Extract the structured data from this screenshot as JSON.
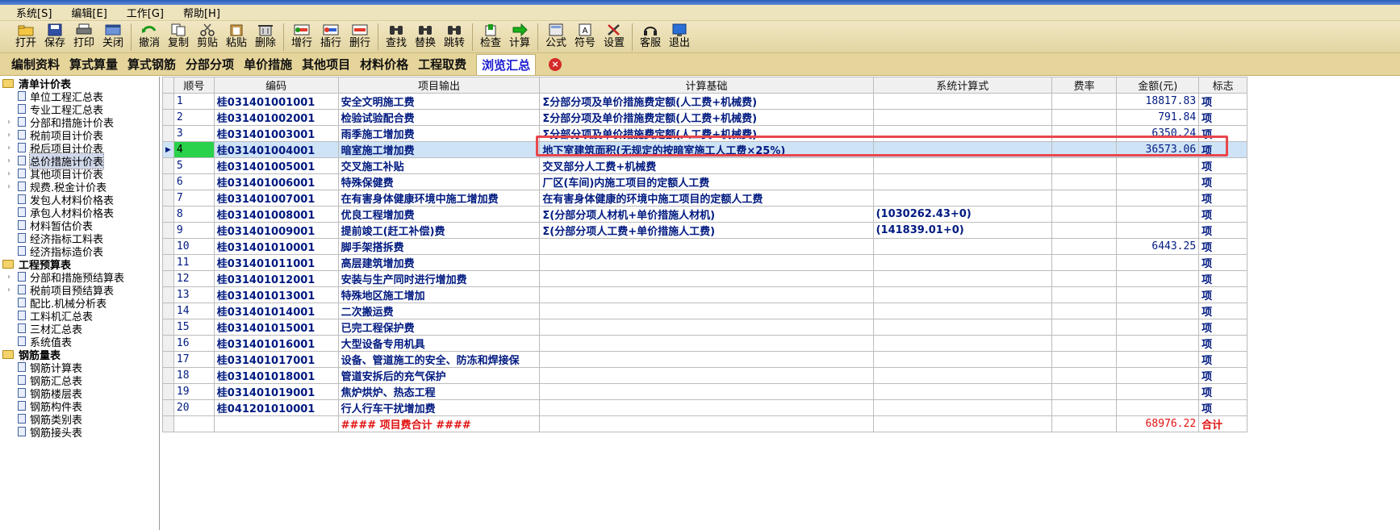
{
  "menu": [
    "系统[S]",
    "编辑[E]",
    "工作[G]",
    "帮助[H]"
  ],
  "toolbar": [
    {
      "label": "打开",
      "icon": "open-folder-icon"
    },
    {
      "label": "保存",
      "icon": "save-icon"
    },
    {
      "label": "打印",
      "icon": "print-icon"
    },
    {
      "label": "关闭",
      "icon": "close-window-icon"
    },
    {
      "sep": true
    },
    {
      "label": "撤消",
      "icon": "undo-icon"
    },
    {
      "label": "复制",
      "icon": "copy-icon"
    },
    {
      "label": "剪贴",
      "icon": "cut-icon"
    },
    {
      "label": "粘贴",
      "icon": "paste-icon"
    },
    {
      "label": "删除",
      "icon": "delete-icon"
    },
    {
      "sep": true
    },
    {
      "label": "增行",
      "icon": "add-row-icon"
    },
    {
      "label": "插行",
      "icon": "insert-row-icon"
    },
    {
      "label": "删行",
      "icon": "delete-row-icon"
    },
    {
      "sep": true
    },
    {
      "label": "查找",
      "icon": "find-icon"
    },
    {
      "label": "替换",
      "icon": "replace-icon"
    },
    {
      "label": "跳转",
      "icon": "jump-icon"
    },
    {
      "sep": true
    },
    {
      "label": "检查",
      "icon": "check-icon"
    },
    {
      "label": "计算",
      "icon": "calculate-icon"
    },
    {
      "sep": true
    },
    {
      "label": "公式",
      "icon": "formula-icon"
    },
    {
      "label": "符号",
      "icon": "symbol-icon"
    },
    {
      "label": "设置",
      "icon": "settings-icon"
    },
    {
      "sep": true
    },
    {
      "label": "客服",
      "icon": "headset-icon"
    },
    {
      "label": "退出",
      "icon": "exit-icon"
    }
  ],
  "tabs": [
    {
      "label": "编制资料",
      "active": false
    },
    {
      "label": "算式算量",
      "active": false
    },
    {
      "label": "算式钢筋",
      "active": false
    },
    {
      "label": "分部分项",
      "active": false
    },
    {
      "label": "单价措施",
      "active": false
    },
    {
      "label": "其他项目",
      "active": false
    },
    {
      "label": "材料价格",
      "active": false
    },
    {
      "label": "工程取费",
      "active": false
    },
    {
      "label": "浏览汇总",
      "active": true
    }
  ],
  "tree": [
    {
      "group": "清单计价表",
      "items": [
        {
          "label": "单位工程汇总表",
          "exp": false
        },
        {
          "label": "专业工程汇总表",
          "exp": false
        },
        {
          "label": "分部和措施计价表",
          "exp": true
        },
        {
          "label": "税前项目计价表",
          "exp": true
        },
        {
          "label": "税后项目计价表",
          "exp": true
        },
        {
          "label": "总价措施计价表",
          "exp": true,
          "selected": true
        },
        {
          "label": "其他项目计价表",
          "exp": true
        },
        {
          "label": "规费.税金计价表",
          "exp": true
        },
        {
          "label": "发包人材料价格表",
          "exp": false
        },
        {
          "label": "承包人材料价格表",
          "exp": false
        },
        {
          "label": "材料暂估价表",
          "exp": false
        },
        {
          "label": "经济指标工料表",
          "exp": false
        },
        {
          "label": "经济指标造价表",
          "exp": false
        }
      ]
    },
    {
      "group": "工程预算表",
      "items": [
        {
          "label": "分部和措施预结算表",
          "exp": true
        },
        {
          "label": "税前项目预结算表",
          "exp": true
        },
        {
          "label": "配比.机械分析表",
          "exp": false
        },
        {
          "label": "工料机汇总表",
          "exp": false
        },
        {
          "label": "三材汇总表",
          "exp": false
        },
        {
          "label": "系统值表",
          "exp": false
        }
      ]
    },
    {
      "group": "钢筋量表",
      "items": [
        {
          "label": "钢筋计算表",
          "exp": false
        },
        {
          "label": "钢筋汇总表",
          "exp": false
        },
        {
          "label": "钢筋楼层表",
          "exp": false
        },
        {
          "label": "钢筋构件表",
          "exp": false
        },
        {
          "label": "钢筋类别表",
          "exp": false
        },
        {
          "label": "钢筋接头表",
          "exp": false
        }
      ]
    }
  ],
  "grid": {
    "columns": [
      "顺号",
      "编码",
      "项目输出",
      "计算基础",
      "系统计算式",
      "费率",
      "金额(元)",
      "标志"
    ],
    "rows": [
      {
        "seq": "1",
        "code": "桂031401001001",
        "item": "安全文明施工费",
        "basis": "Σ分部分项及单价措施费定额(人工费+机械费)",
        "formula": "",
        "rate": "",
        "amount": "18817.83",
        "flag": "项"
      },
      {
        "seq": "2",
        "code": "桂031401002001",
        "item": "检验试验配合费",
        "basis": "Σ分部分项及单价措施费定额(人工费+机械费)",
        "formula": "",
        "rate": "",
        "amount": "791.84",
        "flag": "项"
      },
      {
        "seq": "3",
        "code": "桂031401003001",
        "item": "雨季施工增加费",
        "basis": "Σ分部分项及单价措施费定额(人工费+机械费)",
        "formula": "",
        "rate": "",
        "amount": "6350.24",
        "flag": "项"
      },
      {
        "seq": "4",
        "code": "桂031401004001",
        "item": "暗室施工增加费",
        "basis": "地下室建筑面积(无规定的按暗室施工人工费×25%)",
        "formula": "",
        "rate": "",
        "amount": "36573.06",
        "flag": "项",
        "selected": true
      },
      {
        "seq": "5",
        "code": "桂031401005001",
        "item": "交叉施工补贴",
        "basis": "交叉部分人工费+机械费",
        "formula": "",
        "rate": "",
        "amount": "",
        "flag": "项"
      },
      {
        "seq": "6",
        "code": "桂031401006001",
        "item": "特殊保健费",
        "basis": "厂区(车间)内施工项目的定额人工费",
        "formula": "",
        "rate": "",
        "amount": "",
        "flag": "项"
      },
      {
        "seq": "7",
        "code": "桂031401007001",
        "item": "在有害身体健康环境中施工增加费",
        "basis": "在有害身体健康的环境中施工项目的定额人工费",
        "formula": "",
        "rate": "",
        "amount": "",
        "flag": "项"
      },
      {
        "seq": "8",
        "code": "桂031401008001",
        "item": "优良工程增加费",
        "basis": "Σ(分部分项人材机+单价措施人材机)",
        "formula": "(1030262.43+0)",
        "rate": "",
        "amount": "",
        "flag": "项"
      },
      {
        "seq": "9",
        "code": "桂031401009001",
        "item": "提前竣工(赶工补偿)费",
        "basis": "Σ(分部分项人工费+单价措施人工费)",
        "formula": "(141839.01+0)",
        "rate": "",
        "amount": "",
        "flag": "项"
      },
      {
        "seq": "10",
        "code": "桂031401010001",
        "item": "脚手架搭拆费",
        "basis": "",
        "formula": "",
        "rate": "",
        "amount": "6443.25",
        "flag": "项"
      },
      {
        "seq": "11",
        "code": "桂031401011001",
        "item": "高层建筑增加费",
        "basis": "",
        "formula": "",
        "rate": "",
        "amount": "",
        "flag": "项"
      },
      {
        "seq": "12",
        "code": "桂031401012001",
        "item": "安装与生产同时进行增加费",
        "basis": "",
        "formula": "",
        "rate": "",
        "amount": "",
        "flag": "项"
      },
      {
        "seq": "13",
        "code": "桂031401013001",
        "item": "特殊地区施工增加",
        "basis": "",
        "formula": "",
        "rate": "",
        "amount": "",
        "flag": "项"
      },
      {
        "seq": "14",
        "code": "桂031401014001",
        "item": "二次搬运费",
        "basis": "",
        "formula": "",
        "rate": "",
        "amount": "",
        "flag": "项"
      },
      {
        "seq": "15",
        "code": "桂031401015001",
        "item": "已完工程保护费",
        "basis": "",
        "formula": "",
        "rate": "",
        "amount": "",
        "flag": "项"
      },
      {
        "seq": "16",
        "code": "桂031401016001",
        "item": "大型设备专用机具",
        "basis": "",
        "formula": "",
        "rate": "",
        "amount": "",
        "flag": "项"
      },
      {
        "seq": "17",
        "code": "桂031401017001",
        "item": "设备、管道施工的安全、防冻和焊接保",
        "basis": "",
        "formula": "",
        "rate": "",
        "amount": "",
        "flag": "项"
      },
      {
        "seq": "18",
        "code": "桂031401018001",
        "item": "管道安拆后的充气保护",
        "basis": "",
        "formula": "",
        "rate": "",
        "amount": "",
        "flag": "项"
      },
      {
        "seq": "19",
        "code": "桂031401019001",
        "item": "焦炉烘炉、热态工程",
        "basis": "",
        "formula": "",
        "rate": "",
        "amount": "",
        "flag": "项"
      },
      {
        "seq": "20",
        "code": "桂041201010001",
        "item": "行人行车干扰增加费",
        "basis": "",
        "formula": "",
        "rate": "",
        "amount": "",
        "flag": "项"
      }
    ],
    "total": {
      "item": "#### 项目费合计 ####",
      "amount": "68976.22",
      "flag": "合计"
    }
  },
  "colors": {
    "accent": "#1a1ad0",
    "selected_seq": "#29d24a",
    "selected_row": "#cfe3f7",
    "highlight_box": "#e8474c",
    "total_text": "#e01010"
  }
}
